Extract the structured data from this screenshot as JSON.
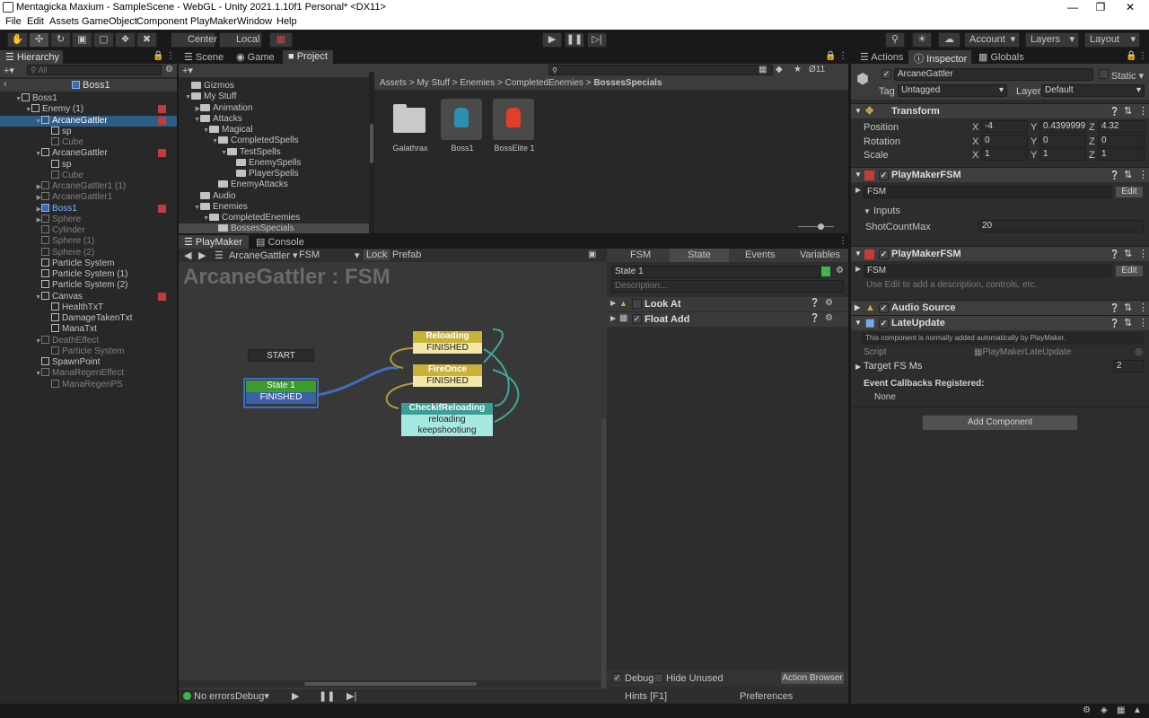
{
  "window": {
    "title": "Mentagicka Maxium - SampleScene - WebGL - Unity 2021.1.10f1 Personal* <DX11>"
  },
  "menu": [
    "File",
    "Edit",
    "Assets",
    "GameObject",
    "Component",
    "PlayMaker",
    "Window",
    "Help"
  ],
  "toolbar": {
    "pivot": "Center",
    "space": "Local",
    "account": "Account",
    "layers": "Layers",
    "layout": "Layout"
  },
  "hierarchy": {
    "tab": "Hierarchy",
    "search_placeholder": "All",
    "breadcrumb": "Boss1",
    "rows": [
      {
        "label": "Boss1",
        "indent": 0,
        "style": "normal",
        "arrow": "▼"
      },
      {
        "label": "Enemy (1)",
        "indent": 1,
        "style": "normal",
        "arrow": "▼",
        "pm": true
      },
      {
        "label": "ArcaneGattler",
        "indent": 2,
        "style": "selected",
        "arrow": "▼",
        "pm": true
      },
      {
        "label": "sp",
        "indent": 3,
        "style": "normal",
        "arrow": ""
      },
      {
        "label": "Cube",
        "indent": 3,
        "style": "gray",
        "arrow": ""
      },
      {
        "label": "ArcaneGattler",
        "indent": 2,
        "style": "normal",
        "arrow": "▼",
        "pm": true
      },
      {
        "label": "sp",
        "indent": 3,
        "style": "normal",
        "arrow": ""
      },
      {
        "label": "Cube",
        "indent": 3,
        "style": "gray",
        "arrow": ""
      },
      {
        "label": "ArcaneGattler1 (1)",
        "indent": 2,
        "style": "gray",
        "arrow": "▶"
      },
      {
        "label": "ArcaneGattler1",
        "indent": 2,
        "style": "gray",
        "arrow": "▶"
      },
      {
        "label": "Boss1",
        "indent": 2,
        "style": "blue",
        "arrow": "▶",
        "pm": true
      },
      {
        "label": "Sphere",
        "indent": 2,
        "style": "gray",
        "arrow": "▶"
      },
      {
        "label": "Cylinder",
        "indent": 2,
        "style": "gray",
        "arrow": ""
      },
      {
        "label": "Sphere (1)",
        "indent": 2,
        "style": "gray",
        "arrow": ""
      },
      {
        "label": "Sphere (2)",
        "indent": 2,
        "style": "gray",
        "arrow": ""
      },
      {
        "label": "Particle System",
        "indent": 2,
        "style": "normal",
        "arrow": ""
      },
      {
        "label": "Particle System (1)",
        "indent": 2,
        "style": "normal",
        "arrow": ""
      },
      {
        "label": "Particle System (2)",
        "indent": 2,
        "style": "normal",
        "arrow": ""
      },
      {
        "label": "Canvas",
        "indent": 2,
        "style": "normal",
        "arrow": "▼",
        "pm": true
      },
      {
        "label": "HealthTxT",
        "indent": 3,
        "style": "normal",
        "arrow": ""
      },
      {
        "label": "DamageTakenTxt",
        "indent": 3,
        "style": "normal",
        "arrow": ""
      },
      {
        "label": "ManaTxt",
        "indent": 3,
        "style": "normal",
        "arrow": ""
      },
      {
        "label": "DeathEffect",
        "indent": 2,
        "style": "gray",
        "arrow": "▼"
      },
      {
        "label": "Particle System",
        "indent": 3,
        "style": "gray",
        "arrow": ""
      },
      {
        "label": "SpawnPoint",
        "indent": 2,
        "style": "normal",
        "arrow": ""
      },
      {
        "label": "ManaRegenEffect",
        "indent": 2,
        "style": "gray",
        "arrow": "▼"
      },
      {
        "label": "ManaRegenPS",
        "indent": 3,
        "style": "gray",
        "arrow": ""
      }
    ]
  },
  "project": {
    "tabs": [
      "Scene",
      "Game",
      "Project"
    ],
    "hidden_count": "11",
    "tree": [
      {
        "label": "Gizmos",
        "indent": 1,
        "arrow": ""
      },
      {
        "label": "My Stuff",
        "indent": 1,
        "arrow": "▼"
      },
      {
        "label": "Animation",
        "indent": 2,
        "arrow": "▶"
      },
      {
        "label": "Attacks",
        "indent": 2,
        "arrow": "▼"
      },
      {
        "label": "Magical",
        "indent": 3,
        "arrow": "▼"
      },
      {
        "label": "CompletedSpells",
        "indent": 4,
        "arrow": "▼"
      },
      {
        "label": "TestSpells",
        "indent": 5,
        "arrow": "▼"
      },
      {
        "label": "EnemySpells",
        "indent": 6,
        "arrow": ""
      },
      {
        "label": "PlayerSpells",
        "indent": 6,
        "arrow": ""
      },
      {
        "label": "EnemyAttacks",
        "indent": 4,
        "arrow": ""
      },
      {
        "label": "Audio",
        "indent": 2,
        "arrow": ""
      },
      {
        "label": "Enemies",
        "indent": 2,
        "arrow": "▼"
      },
      {
        "label": "CompletedEnemies",
        "indent": 3,
        "arrow": "▼"
      },
      {
        "label": "BossesSpecials",
        "indent": 4,
        "arrow": ""
      }
    ],
    "breadcrumb": [
      "Assets",
      "My Stuff",
      "Enemies",
      "CompletedEnemies",
      "BossesSpecials"
    ],
    "assets": [
      {
        "label": "Galathrax",
        "kind": "folder"
      },
      {
        "label": "Boss1",
        "kind": "prefab-blue"
      },
      {
        "label": "BossElite 1",
        "kind": "prefab-red"
      }
    ]
  },
  "playmaker": {
    "tabs": [
      "PlayMaker",
      "Console"
    ],
    "object": "ArcaneGattler",
    "fsm": "FSM",
    "lock": "Lock",
    "prefab": "Prefab",
    "title": "ArcaneGattler : FSM",
    "start": "START",
    "states": [
      {
        "name": "State 1",
        "events": [
          "FINISHED"
        ]
      },
      {
        "name": "Reloading",
        "events": [
          "FINISHED"
        ]
      },
      {
        "name": "FireOnce",
        "events": [
          "FINISHED"
        ]
      },
      {
        "name": "CheckifReloading",
        "events": [
          "reloading",
          "keepshootiung"
        ]
      }
    ],
    "status": "No errors",
    "debug_mode": "Debug",
    "side_tabs": [
      "FSM",
      "State",
      "Events",
      "Variables"
    ],
    "state_name": "State 1",
    "description_placeholder": "Description...",
    "actions": [
      "Look At",
      "Float Add"
    ],
    "debug_label": "Debug",
    "hide_unused": "Hide Unused",
    "action_browser": "Action Browser",
    "hints": "Hints [F1]",
    "preferences": "Preferences"
  },
  "inspector": {
    "tabs": [
      "Actions",
      "Inspector",
      "Globals"
    ],
    "object_name": "ArcaneGattler",
    "static": "Static",
    "tag_label": "Tag",
    "tag_value": "Untagged",
    "layer_label": "Layer",
    "layer_value": "Default",
    "transform": {
      "title": "Transform",
      "rows": [
        {
          "label": "Position",
          "x": "-4",
          "y": "0.4399999",
          "z": "4.32"
        },
        {
          "label": "Rotation",
          "x": "0",
          "y": "0",
          "z": "0"
        },
        {
          "label": "Scale",
          "x": "1",
          "y": "1",
          "z": "1"
        }
      ]
    },
    "fsm1": {
      "title": "PlayMakerFSM",
      "fsm_name": "FSM",
      "edit": "Edit",
      "inputs": "Inputs",
      "var_label": "ShotCountMax",
      "var_value": "20"
    },
    "fsm2": {
      "title": "PlayMakerFSM",
      "fsm_name": "FSM",
      "edit": "Edit",
      "hint": "Use Edit to add a description, controls, etc."
    },
    "audio": {
      "title": "Audio Source"
    },
    "late": {
      "title": "LateUpdate",
      "note": "This component is normally added automatically by PlayMaker.",
      "script_label": "Script",
      "script_value": "PlayMakerLateUpdate",
      "target_label": "Target FS Ms",
      "target_value": "2",
      "callbacks_label": "Event Callbacks Registered:",
      "callbacks_value": "None"
    },
    "add_component": "Add Component"
  },
  "colors": {
    "selection": "#2c5d87",
    "state_green": "#3d9b2f",
    "state_blue": "#3b5fa8",
    "state_yellow": "#c8b23a",
    "state_cyan": "#9fe3df",
    "link_blue": "#3f6fb8",
    "link_yellow": "#b79a3c",
    "link_teal": "#3ea89c"
  }
}
